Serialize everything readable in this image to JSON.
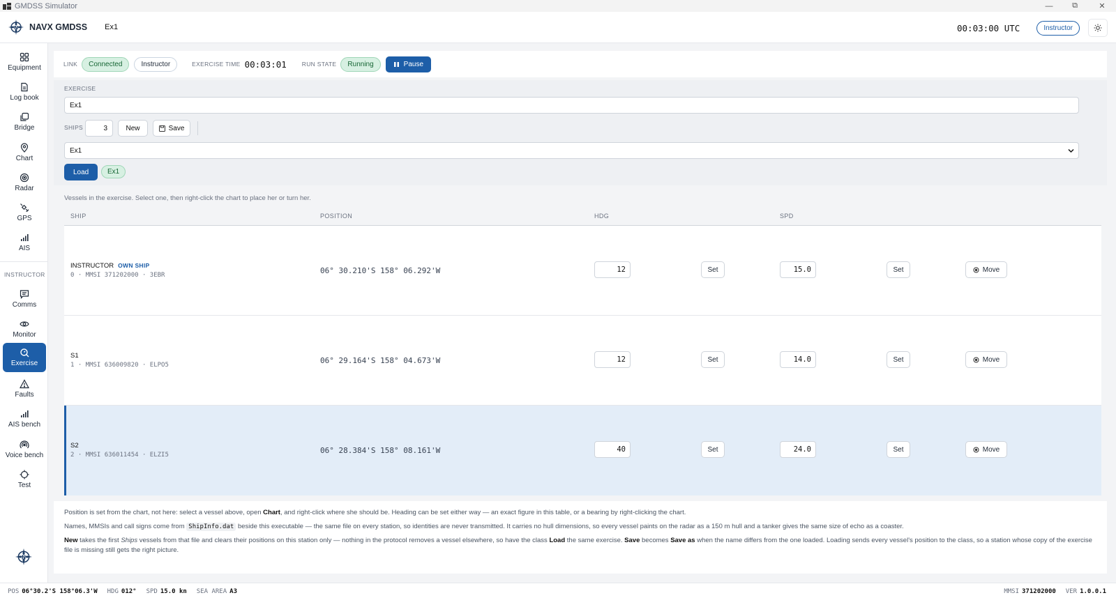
{
  "window": {
    "title": "GMDSS Simulator"
  },
  "header": {
    "brand": "NAVX GMDSS",
    "exercise": "Ex1",
    "utc": "00:03:00 UTC",
    "role": "Instructor"
  },
  "sidebar": {
    "items": [
      {
        "label": "Equipment",
        "icon": "grid-icon"
      },
      {
        "label": "Log book",
        "icon": "document-icon"
      },
      {
        "label": "Bridge",
        "icon": "layers-icon"
      },
      {
        "label": "Chart",
        "icon": "map-pin-icon"
      },
      {
        "label": "Radar",
        "icon": "radar-icon"
      },
      {
        "label": "GPS",
        "icon": "satellite-icon"
      },
      {
        "label": "AIS",
        "icon": "signal-bars-icon"
      }
    ],
    "section": "INSTRUCTOR",
    "instructor_items": [
      {
        "label": "Comms",
        "icon": "message-icon"
      },
      {
        "label": "Monitor",
        "icon": "eye-icon"
      },
      {
        "label": "Exercise",
        "icon": "search-icon",
        "active": true
      },
      {
        "label": "Faults",
        "icon": "warning-icon"
      },
      {
        "label": "AIS bench",
        "icon": "signal-bars-icon"
      },
      {
        "label": "Voice bench",
        "icon": "broadcast-icon"
      },
      {
        "label": "Test",
        "icon": "crosshair-icon"
      }
    ]
  },
  "status": {
    "link_label": "LINK",
    "link_state": "Connected",
    "role": "Instructor",
    "exercise_time_label": "EXERCISE TIME",
    "exercise_time": "00:03:01",
    "run_state_label": "RUN STATE",
    "run_state": "Running",
    "pause_label": "Pause"
  },
  "exercise": {
    "label": "EXERCISE",
    "name": "Ex1",
    "ships_label": "SHIPS",
    "ships_count": "3",
    "new_label": "New",
    "save_label": "Save",
    "selected": "Ex1",
    "load_label": "Load",
    "loaded_badge": "Ex1"
  },
  "table": {
    "hint": "Vessels in the exercise. Select one, then right-click the chart to place her or turn her.",
    "headers": {
      "ship": "SHIP",
      "position": "POSITION",
      "hdg": "HDG",
      "spd": "SPD"
    },
    "set_label": "Set",
    "move_label": "Move",
    "rows": [
      {
        "name": "INSTRUCTOR",
        "tag": "OWN SHIP",
        "sub": "0 · MMSI 371202000 · 3EBR",
        "position": "06° 30.210'S 158° 06.292'W",
        "hdg": "12",
        "spd": "15.0"
      },
      {
        "name": "S1",
        "tag": "",
        "sub": "1 · MMSI 636009820 · ELPO5",
        "position": "06° 29.164'S 158° 04.673'W",
        "hdg": "12",
        "spd": "14.0"
      },
      {
        "name": "S2",
        "tag": "",
        "sub": "2 · MMSI 636011454 · ELZI5",
        "position": "06° 28.384'S 158° 08.161'W",
        "hdg": "40",
        "spd": "24.0"
      }
    ]
  },
  "notes": {
    "p1_a": "Position is set from the chart, not here: select a vessel above, open ",
    "p1_b": "Chart",
    "p1_c": ", and right-click where she should be. Heading can be set either way — an exact figure in this table, or a bearing by right-clicking the chart.",
    "p2_a": "Names, MMSIs and call signs come from ",
    "p2_code": "ShipInfo.dat",
    "p2_b": " beside this executable — the same file on every station, so identities are never transmitted. It carries no hull dimensions, so every vessel paints on the radar as a 150 m hull and a tanker gives the same size of echo as a coaster.",
    "p3_a": "New",
    "p3_b": " takes the first ",
    "p3_c": "Ships",
    "p3_d": " vessels from that file and clears their positions on this station only — nothing in the protocol removes a vessel elsewhere, so have the class ",
    "p3_e": "Load",
    "p3_f": " the same exercise. ",
    "p3_g": "Save",
    "p3_h": " becomes ",
    "p3_i": "Save as",
    "p3_j": " when the name differs from the one loaded. Loading sends every vessel's position to the class, so a station whose copy of the exercise file is missing still gets the right picture."
  },
  "bottombar": {
    "pos_label": "POS",
    "pos": "06°30.2'S 158°06.3'W",
    "hdg_label": "HDG",
    "hdg": "012°",
    "spd_label": "SPD",
    "spd": "15.0 kn",
    "sea_label": "SEA AREA",
    "sea": "A3",
    "mmsi_label": "MMSI",
    "mmsi": "371202000",
    "ver_label": "VER",
    "ver": "1.0.0.1"
  },
  "colors": {
    "accent": "#1d5ea8",
    "green_bg": "#d7f0e2",
    "selected_row": "#e3edf8"
  }
}
